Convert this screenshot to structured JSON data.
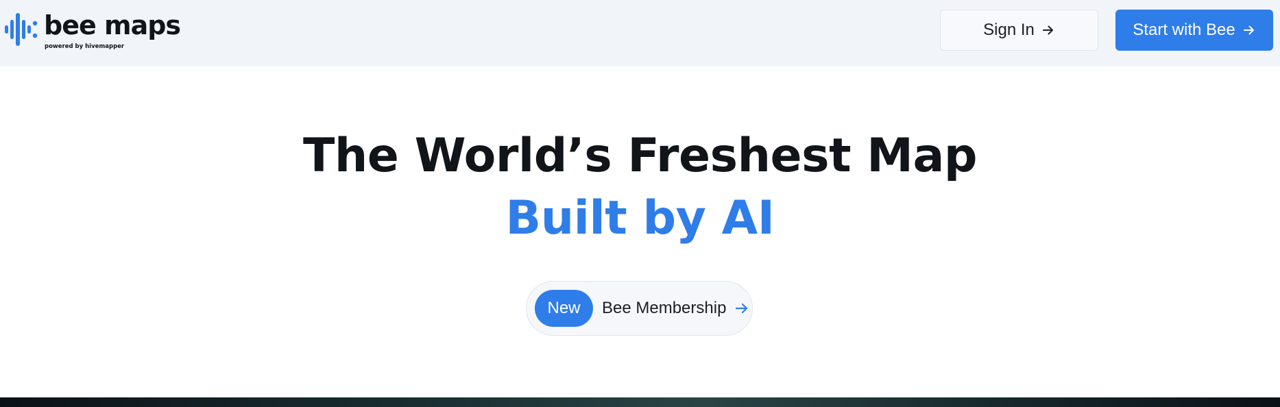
{
  "header": {
    "logo": {
      "wordmark": "bee maps",
      "tagline": "powered by hivemapper",
      "icon": "bee-maps-logo-icon"
    },
    "sign_in": {
      "label": "Sign In",
      "icon": "arrow-right-icon"
    },
    "start": {
      "label": "Start with Bee",
      "icon": "arrow-right-icon"
    }
  },
  "hero": {
    "title": "The World’s Freshest Map",
    "subtitle": "Built by AI",
    "announcement": {
      "badge": "New",
      "label": "Bee Membership",
      "icon": "arrow-right-icon"
    }
  },
  "colors": {
    "accent": "#2f7de9",
    "header_bg": "#f1f4f9",
    "text": "#111418"
  }
}
